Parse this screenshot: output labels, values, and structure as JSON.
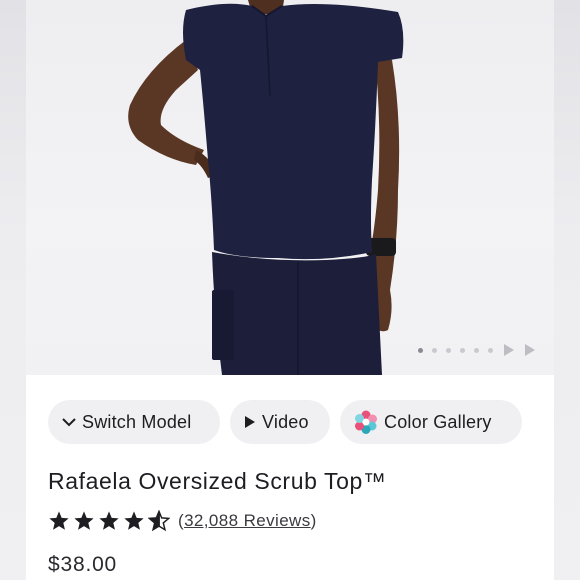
{
  "product": {
    "title": "Rafaela Oversized Scrub Top™",
    "price": "$38.00",
    "rating": 4.5,
    "reviews_open": "(",
    "reviews_text": "32,088 Reviews",
    "reviews_close": ")"
  },
  "actions": {
    "switch_model": {
      "label": "Switch Model",
      "icon": "chevron-down-icon"
    },
    "video": {
      "label": "Video",
      "icon": "play-icon"
    },
    "color_gallery": {
      "label": "Color Gallery",
      "icon": "color-wheel-icon"
    }
  },
  "carousel": {
    "dot_count": 6,
    "active_index": 0,
    "extra": [
      "play-icon",
      "play-icon"
    ]
  },
  "colors": {
    "garment": "#1f2140",
    "skin": "#5a3624",
    "background": "#f3f3f5",
    "text": "#1e1e22",
    "pill": "#f0f0f3"
  }
}
